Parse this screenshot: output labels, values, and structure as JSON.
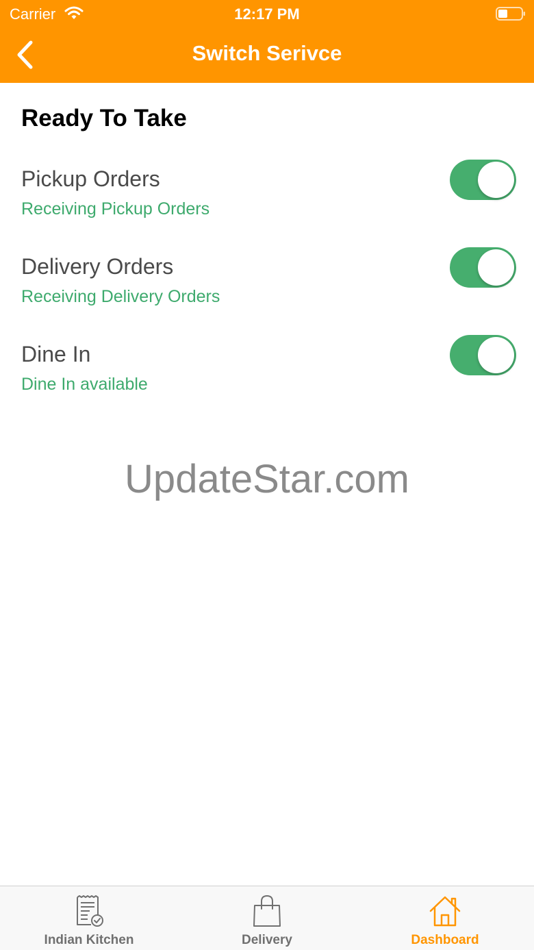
{
  "status_bar": {
    "carrier": "Carrier",
    "time": "12:17 PM"
  },
  "nav": {
    "title": "Switch Serivce",
    "back_icon": "chevron-left-icon"
  },
  "section_title": "Ready To Take",
  "services": [
    {
      "name": "Pickup Orders",
      "status": "Receiving Pickup Orders",
      "enabled": true
    },
    {
      "name": "Delivery Orders",
      "status": "Receiving Delivery Orders",
      "enabled": true
    },
    {
      "name": "Dine In",
      "status": "Dine In available",
      "enabled": true
    }
  ],
  "watermark": "UpdateStar.com",
  "tabs": [
    {
      "label": "Indian Kitchen",
      "icon": "receipt-check-icon",
      "active": false
    },
    {
      "label": "Delivery",
      "icon": "shopping-bag-icon",
      "active": false
    },
    {
      "label": "Dashboard",
      "icon": "home-icon",
      "active": true
    }
  ],
  "colors": {
    "accent": "#FF9500",
    "toggle_on": "#46AE6E",
    "status_text": "#3EAA6D",
    "tab_inactive": "#707070"
  }
}
